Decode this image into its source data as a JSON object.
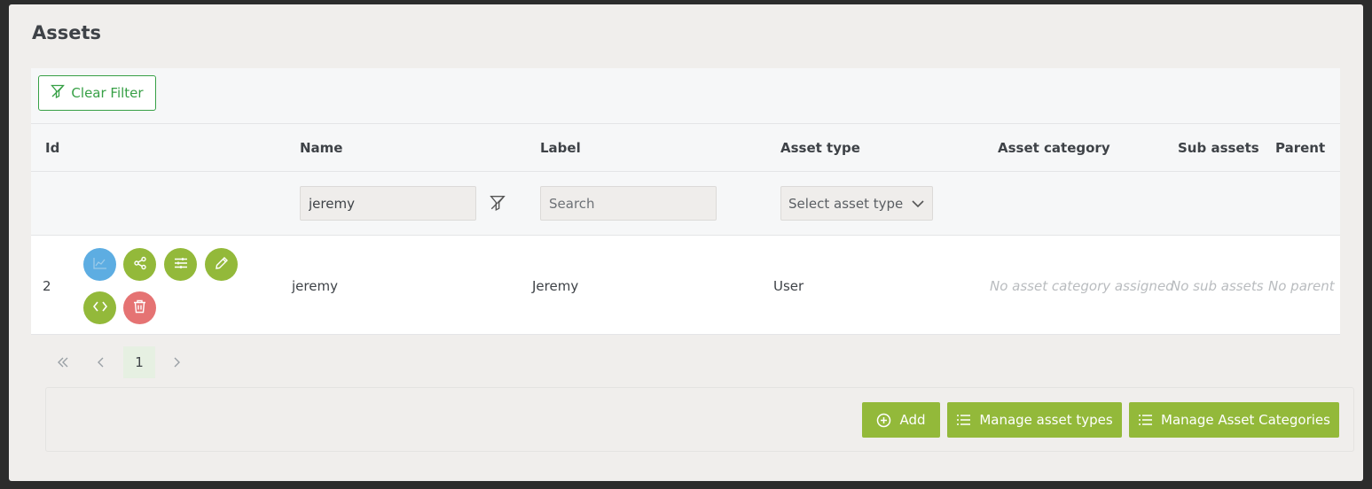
{
  "page": {
    "title": "Assets"
  },
  "toolbar": {
    "clear_filter_label": "Clear Filter"
  },
  "columns": {
    "id": "Id",
    "name": "Name",
    "label": "Label",
    "asset_type": "Asset type",
    "asset_category": "Asset category",
    "sub_assets": "Sub assets",
    "parent": "Parent"
  },
  "filters": {
    "name_value": "jeremy",
    "label_placeholder": "Search",
    "asset_type_placeholder": "Select asset type"
  },
  "rows": [
    {
      "id": "2",
      "name": "jeremy",
      "label": "Jeremy",
      "asset_type": "User",
      "asset_category": "No asset category assigned",
      "sub_assets": "No sub assets",
      "parent": "No parent"
    }
  ],
  "pagination": {
    "current_page": "1"
  },
  "footer": {
    "add_label": "Add",
    "manage_types_label": "Manage asset types",
    "manage_categories_label": "Manage Asset Categories"
  },
  "colors": {
    "accent_green": "#93b93a",
    "outline_green": "#37a046",
    "chart_blue": "#5dade2",
    "delete_red": "#e57373"
  },
  "icons": {
    "row_actions": [
      "chart-icon",
      "share-icon",
      "sliders-icon",
      "pencil-icon",
      "code-icon",
      "trash-icon"
    ]
  }
}
